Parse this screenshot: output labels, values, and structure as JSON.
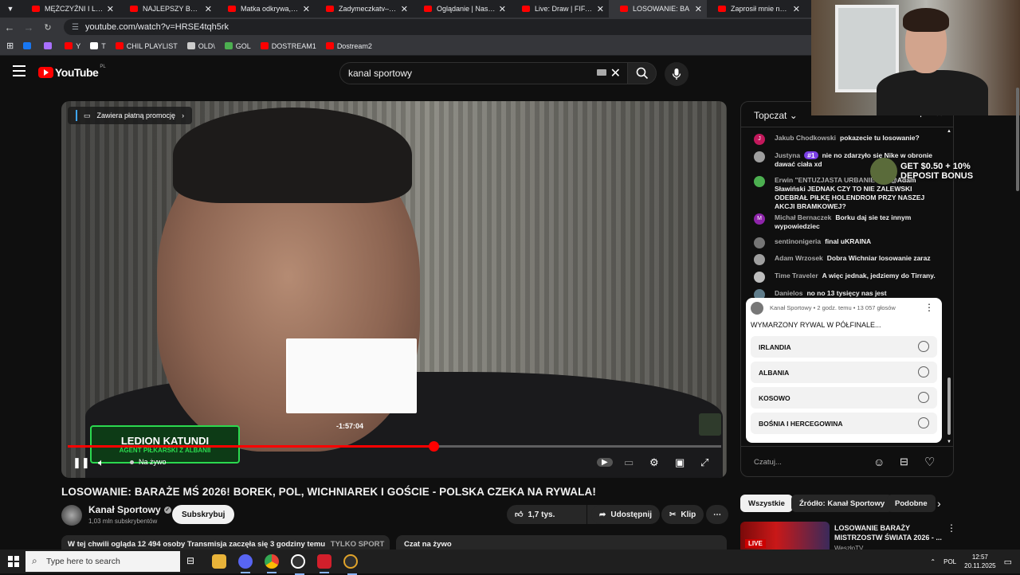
{
  "browser": {
    "tabs": [
      {
        "label": "MĘŻCZYŹNI I LEWICA",
        "active": false
      },
      {
        "label": "NAJLEPSZY BURGER",
        "active": false
      },
      {
        "label": "Matka odkrywa, że jej",
        "active": false
      },
      {
        "label": "Zadymeczkatv– Sezon",
        "active": false
      },
      {
        "label": "Oglądanie | Nasz now",
        "active": false
      },
      {
        "label": "Live: Draw | FIFA Wor",
        "active": false
      },
      {
        "label": "LOSOWANIE: BA",
        "active": true
      },
      {
        "label": "Zaprosił mnie na PRA",
        "active": false
      }
    ],
    "tab_close_glyph": "✕",
    "url": "youtube.com/watch?v=HRSE4tqh5rk",
    "bookmarks": [
      {
        "label": "",
        "color": "#1877f2"
      },
      {
        "label": "",
        "color": "#a970ff"
      },
      {
        "label": "Y",
        "color": "#ff0000"
      },
      {
        "label": "T",
        "color": "#ffffff"
      },
      {
        "label": "CHIL PLAYLIST",
        "color": "#ff0000"
      },
      {
        "label": "OLD\\",
        "color": "#cccccc"
      },
      {
        "label": "GOL",
        "color": "#4caf50"
      },
      {
        "label": "DOSTREAM1",
        "color": "#ff0000"
      },
      {
        "label": "Dostream2",
        "color": "#ff0000"
      }
    ]
  },
  "youtube": {
    "logo_text": "YouTube",
    "logo_country": "PL",
    "search_value": "kanal sportowy",
    "video": {
      "promo_label": "Zawiera płatną promocję",
      "seek_time": "-1:57:04",
      "lower_third_name": "LEDION KATUNDI",
      "lower_third_role": "AGENT PIŁKARSKI Z ALBANII",
      "live_label": "Na żywo",
      "progress_fraction": 0.56,
      "hover_fraction": 0.435
    },
    "title": "LOSOWANIE: BARAŻE MŚ 2026! BOREK, POL, WICHNIAREK I GOŚCIE - POLSKA CZEKA NA RYWALA!",
    "channel": {
      "name": "Kanał Sportowy",
      "subs": "1,03 mln subskrybentów",
      "subscribe_label": "Subskrybuj"
    },
    "actions": {
      "likes": "1,7 tys.",
      "share": "Udostępnij",
      "clip": "Klip"
    },
    "info_bar": {
      "text": "W tej chwili ogląda 12 494 osoby  Transmisja zaczęła się 3 godziny temu",
      "tag": "TYLKO SPORT"
    },
    "chat_now_label": "Czat na żywo",
    "chat": {
      "header": "Topczat",
      "messages": [
        {
          "user": "Jakub Chodkowski",
          "text": "pokazecie tu losowanie?",
          "avatar_letter": "J",
          "avatar_color": "#c2185b"
        },
        {
          "user": "Justyna",
          "badge": "#1",
          "text": "nie no zdarzyło się Nike w obronie dawać ciała xd",
          "avatar_letter": "",
          "avatar_color": "#9e9e9e"
        },
        {
          "user": "Erwin \"ENTUZJASTA URBANIETA\"",
          "text": "@Adam Sławiński JEDNAK CZY TO NIE ZALEWSKI ODEBRAŁ PIŁKĘ HOLENDROM PRZY NASZEJ AKCJI BRAMKOWEJ?",
          "avatar_letter": "",
          "avatar_color": "#4caf50"
        },
        {
          "user": "Michał Bernaczek",
          "text": "Borku daj sie tez innym wypowiedziec",
          "avatar_letter": "M",
          "avatar_color": "#8e24aa"
        },
        {
          "user": "sentinonigeria",
          "text": "final uKRAINA",
          "avatar_letter": "",
          "avatar_color": "#757575"
        },
        {
          "user": "Adam Wrzosek",
          "text": "Dobra Wichniar losowanie zaraz",
          "avatar_letter": "",
          "avatar_color": "#9e9e9e"
        },
        {
          "user": "Time Traveler",
          "text": "A więc jednak, jedziemy do Tirrany.",
          "avatar_letter": "",
          "avatar_color": "#bdbdbd"
        },
        {
          "user": "Danielos",
          "text": "no no 13 tysięcy nas jest",
          "avatar_letter": "",
          "avatar_color": "#607d8b"
        }
      ],
      "poll": {
        "meta": "Kanał Sportowy • 2 godz. temu • 13 057 głosów",
        "question": "WYMARZONY RYWAL W PÓŁFINALE...",
        "options": [
          "IRLANDIA",
          "ALBANIA",
          "KOSOWO",
          "BOŚNIA I HERCEGOWINA"
        ]
      },
      "input_placeholder": "Czatuj..."
    },
    "filter_chips": [
      "Wszystkie",
      "Źródło: Kanał Sportowy",
      "Podobne"
    ],
    "recommended": {
      "title": "LOSOWANIE BARAŻY MISTRZOSTW ŚWIATA 2026 - ...",
      "channel": "WeszłoTV",
      "live_label": "LIVE"
    }
  },
  "overlay": {
    "deposit_text_1": "GET $0.50 + 10%",
    "deposit_text_2": "DEPOSIT BONUS"
  },
  "taskbar": {
    "search_placeholder": "Type here to search",
    "language": "POL",
    "time": "12:57",
    "date": "20.11.2025"
  }
}
